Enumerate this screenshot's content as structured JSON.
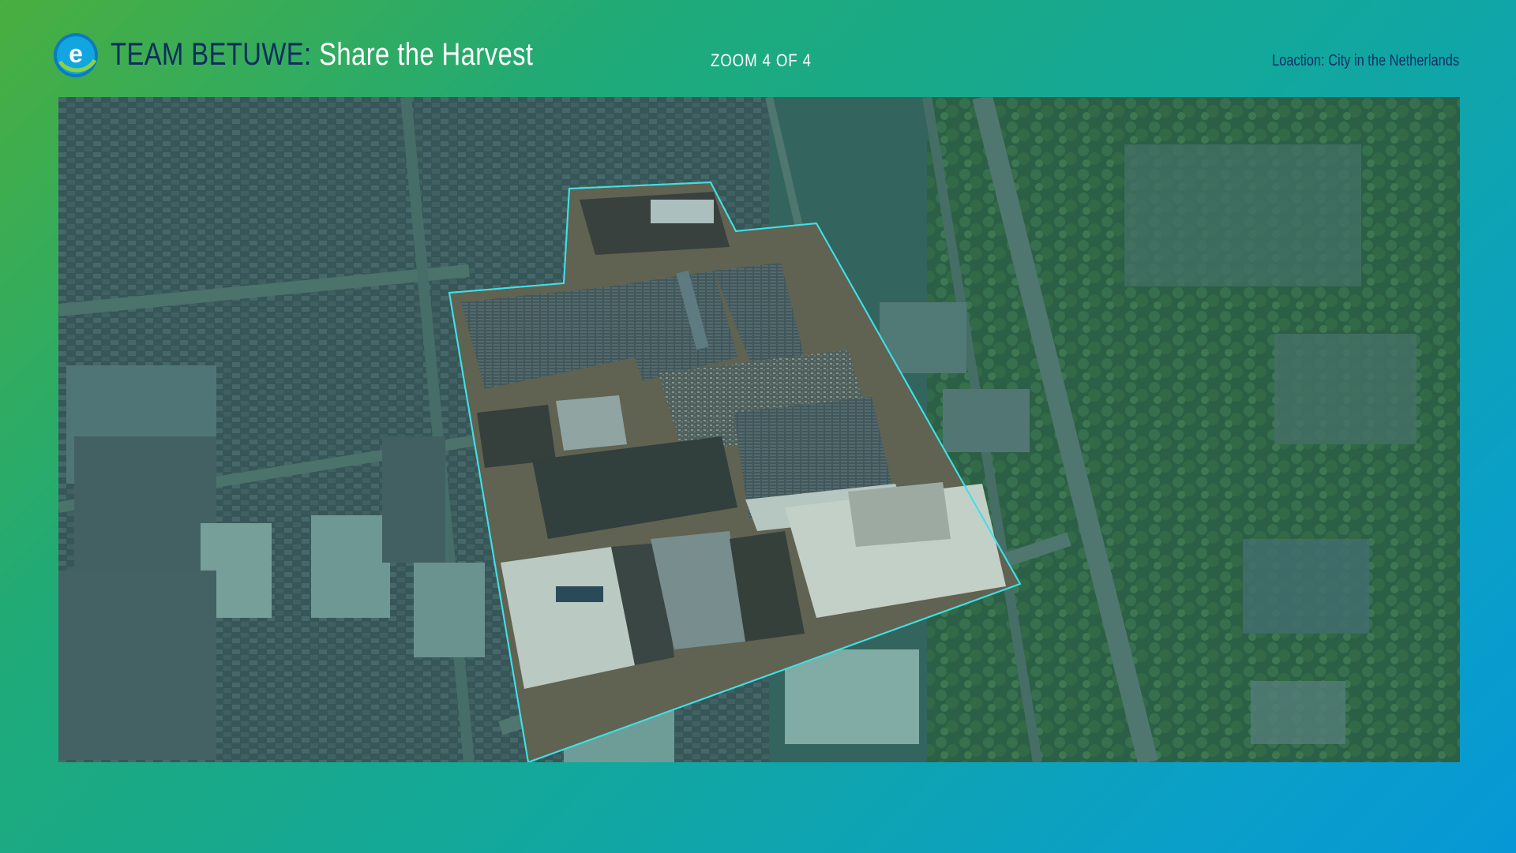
{
  "header": {
    "brand_prefix": "TEAM BETUWE:",
    "brand_title": "Share the Harvest",
    "zoom_label": "ZOOM 4 OF 4",
    "location_label": "Loaction: City in the Netherlands",
    "logo_letter": "e"
  },
  "map": {
    "icon": "aerial-photo",
    "site_outline_color": "#3fe0e6",
    "tint_color": "#1f7f6e"
  },
  "colors": {
    "navy": "#0f2d63",
    "white": "#ffffff",
    "gradient_start": "#4aae3f",
    "gradient_end": "#0698d6"
  }
}
